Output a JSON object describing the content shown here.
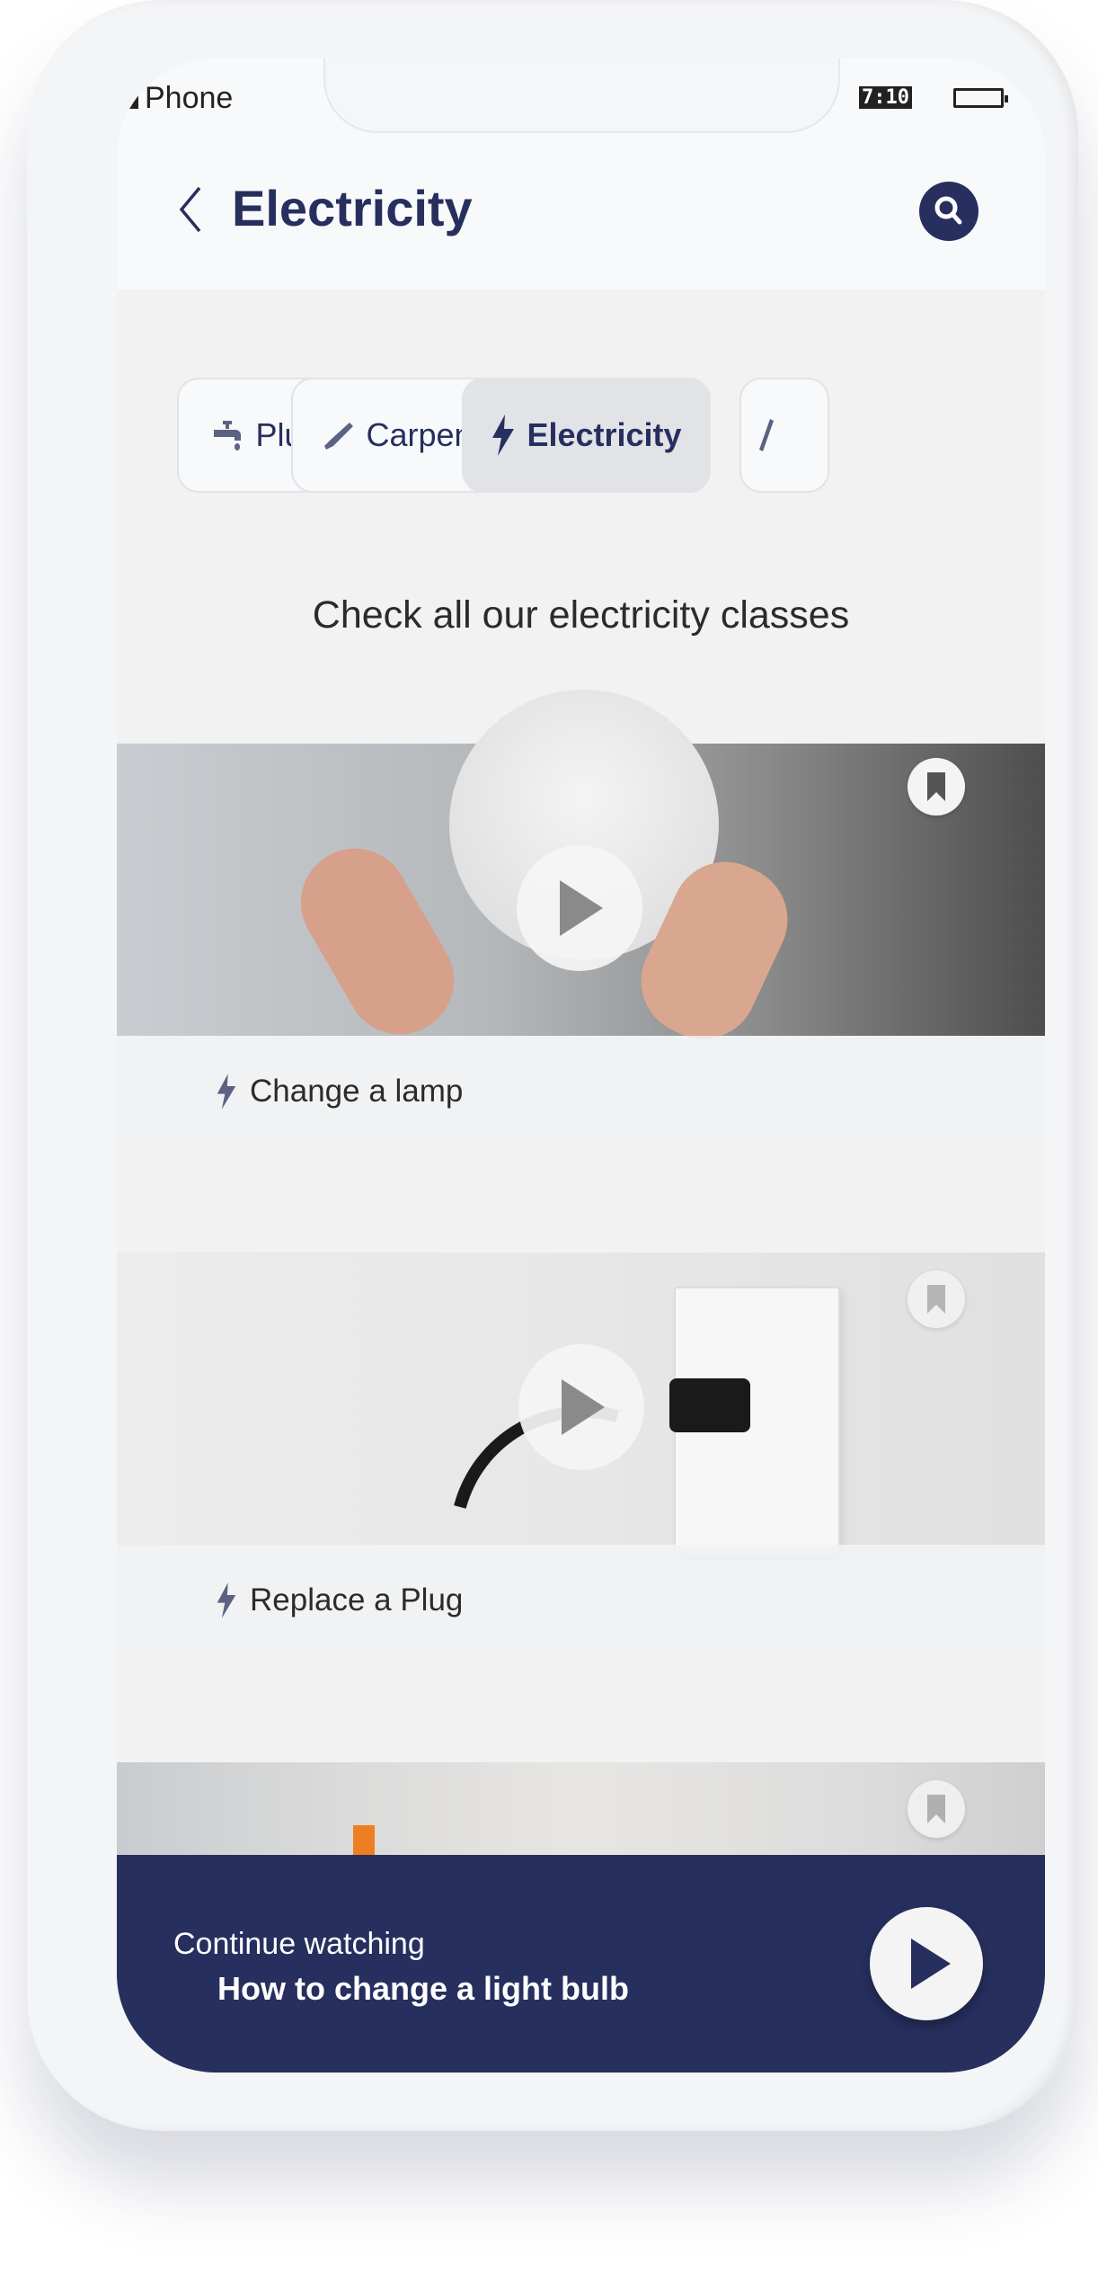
{
  "status_bar": {
    "carrier": "Phone",
    "time": "7:10",
    "signal_icon": "signal-bars-icon",
    "battery_icon": "battery-icon"
  },
  "header": {
    "title": "Electricity",
    "back_icon": "chevron-left-icon",
    "search_icon": "search-icon"
  },
  "categories": [
    {
      "label": "Plumbing",
      "icon": "faucet-icon",
      "active": false
    },
    {
      "label": "Carpentry",
      "icon": "saw-icon",
      "active": false
    },
    {
      "label": "Electricity",
      "icon": "bolt-icon",
      "active": true
    }
  ],
  "subtitle": "Check all  our electricity classes",
  "classes": [
    {
      "title": "Change a lamp",
      "icon": "bolt-icon"
    },
    {
      "title": "Replace a Plug",
      "icon": "bolt-icon"
    }
  ],
  "continue": {
    "label": "Continue watching",
    "title": "How to change a light bulb"
  },
  "colors": {
    "primary": "#262f5e",
    "background": "#f2f2f2",
    "icon_muted": "#5b6282"
  }
}
